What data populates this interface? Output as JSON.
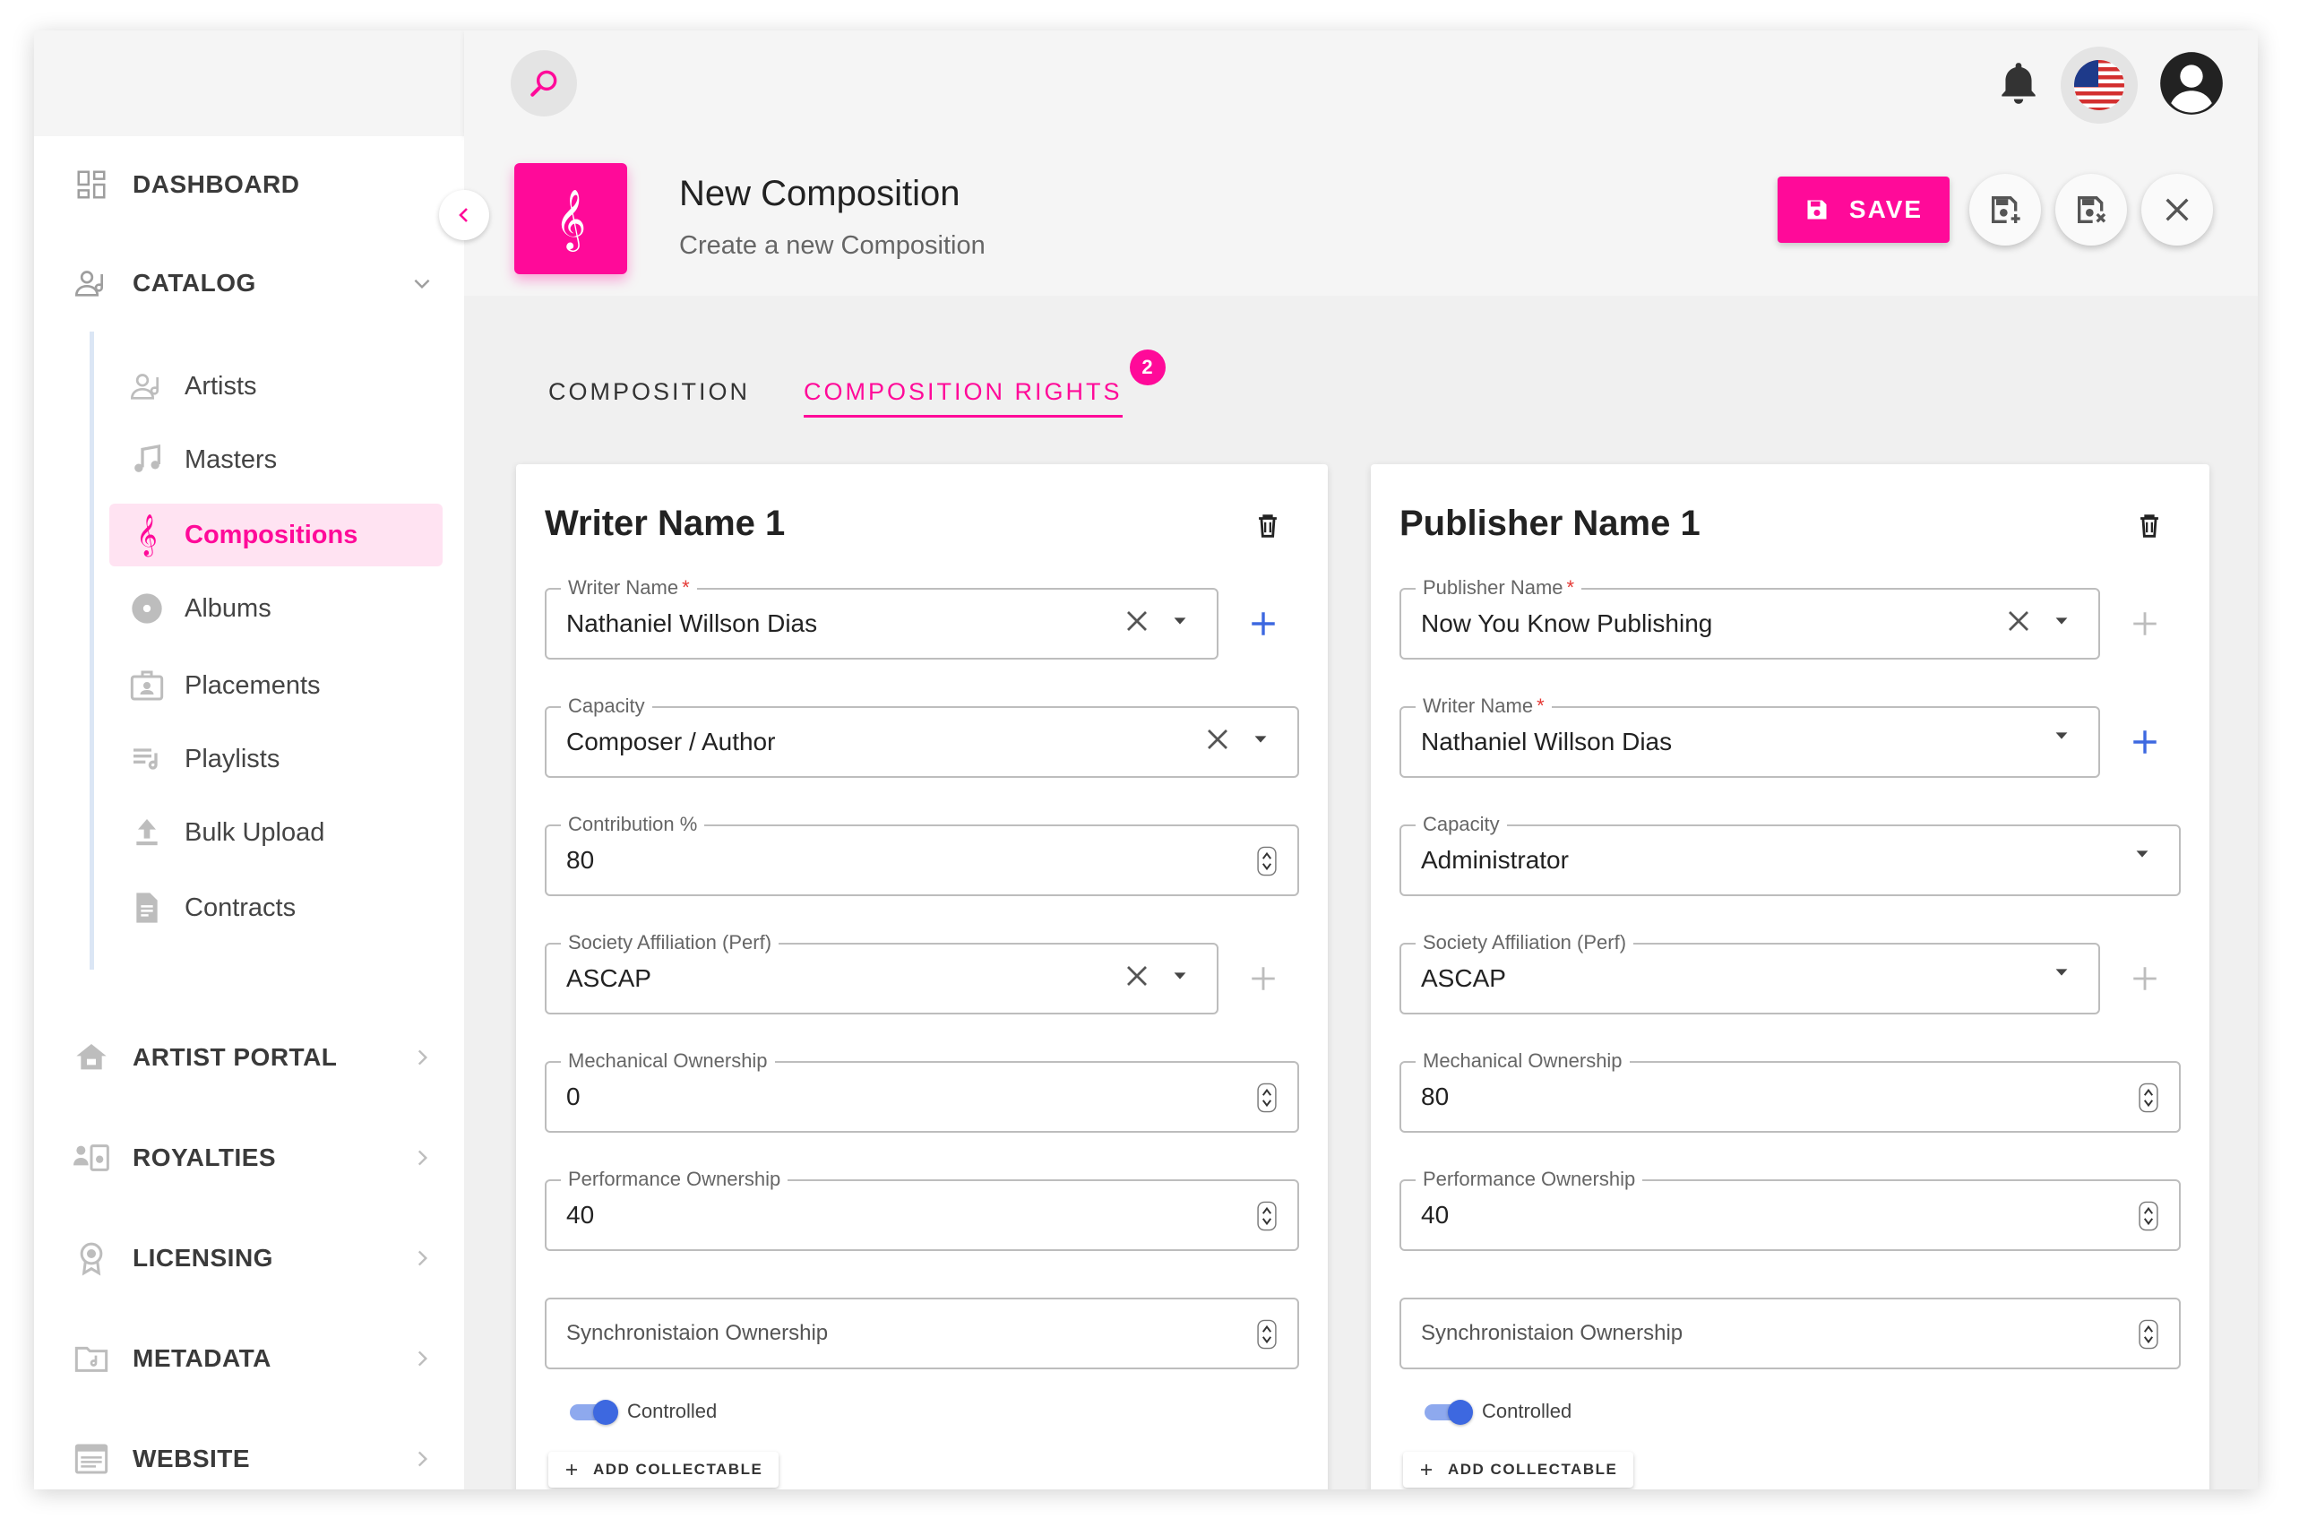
{
  "sidebar": {
    "sections": [
      {
        "label": "DASHBOARD",
        "icon": "dashboard-icon"
      },
      {
        "label": "CATALOG",
        "icon": "catalog-icon"
      }
    ],
    "catalog_items": [
      {
        "label": "Artists",
        "icon": "artist-icon"
      },
      {
        "label": "Masters",
        "icon": "music-note-icon"
      },
      {
        "label": "Compositions",
        "icon": "treble-clef-icon",
        "active": true
      },
      {
        "label": "Albums",
        "icon": "disc-icon"
      },
      {
        "label": "Placements",
        "icon": "placement-icon"
      },
      {
        "label": "Playlists",
        "icon": "playlist-icon"
      },
      {
        "label": "Bulk Upload",
        "icon": "upload-icon"
      },
      {
        "label": "Contracts",
        "icon": "contract-icon"
      }
    ],
    "lower_sections": [
      {
        "label": "ARTIST PORTAL",
        "icon": "home-icon"
      },
      {
        "label": "ROYALTIES",
        "icon": "royalties-icon"
      },
      {
        "label": "LICENSING",
        "icon": "licensing-icon"
      },
      {
        "label": "METADATA",
        "icon": "metadata-icon"
      },
      {
        "label": "WEBSITE",
        "icon": "website-icon"
      }
    ]
  },
  "header": {
    "title": "New Composition",
    "subtitle": "Create a new Composition",
    "save_label": "SAVE"
  },
  "tabs": [
    {
      "label": "COMPOSITION"
    },
    {
      "label": "COMPOSITION RIGHTS",
      "active": true,
      "badge": "2"
    }
  ],
  "writer_card": {
    "title": "Writer Name 1",
    "writer_name": {
      "label": "Writer Name",
      "value": "Nathaniel Willson Dias"
    },
    "capacity": {
      "label": "Capacity",
      "value": "Composer / Author"
    },
    "contribution": {
      "label": "Contribution %",
      "value": "80"
    },
    "society": {
      "label": "Society Affiliation (Perf)",
      "value": "ASCAP"
    },
    "mechanical": {
      "label": "Mechanical Ownership",
      "value": "0"
    },
    "performance": {
      "label": "Performance Ownership",
      "value": "40"
    },
    "sync": {
      "placeholder": "Synchronistaion Ownership"
    },
    "controlled_label": "Controlled",
    "add_collectable": "ADD COLLECTABLE"
  },
  "publisher_card": {
    "title": "Publisher Name 1",
    "publisher_name": {
      "label": "Publisher Name",
      "value": "Now You Know Publishing"
    },
    "writer_name": {
      "label": "Writer Name",
      "value": "Nathaniel Willson Dias"
    },
    "capacity": {
      "label": "Capacity",
      "value": "Administrator"
    },
    "society": {
      "label": "Society Affiliation (Perf)",
      "value": "ASCAP"
    },
    "mechanical": {
      "label": "Mechanical Ownership",
      "value": "80"
    },
    "performance": {
      "label": "Performance Ownership",
      "value": "40"
    },
    "sync": {
      "placeholder": "Synchronistaion Ownership"
    },
    "controlled_label": "Controlled",
    "add_collectable": "ADD COLLECTABLE"
  },
  "colors": {
    "accent": "#ff0a99",
    "blue": "#3d68e0"
  }
}
